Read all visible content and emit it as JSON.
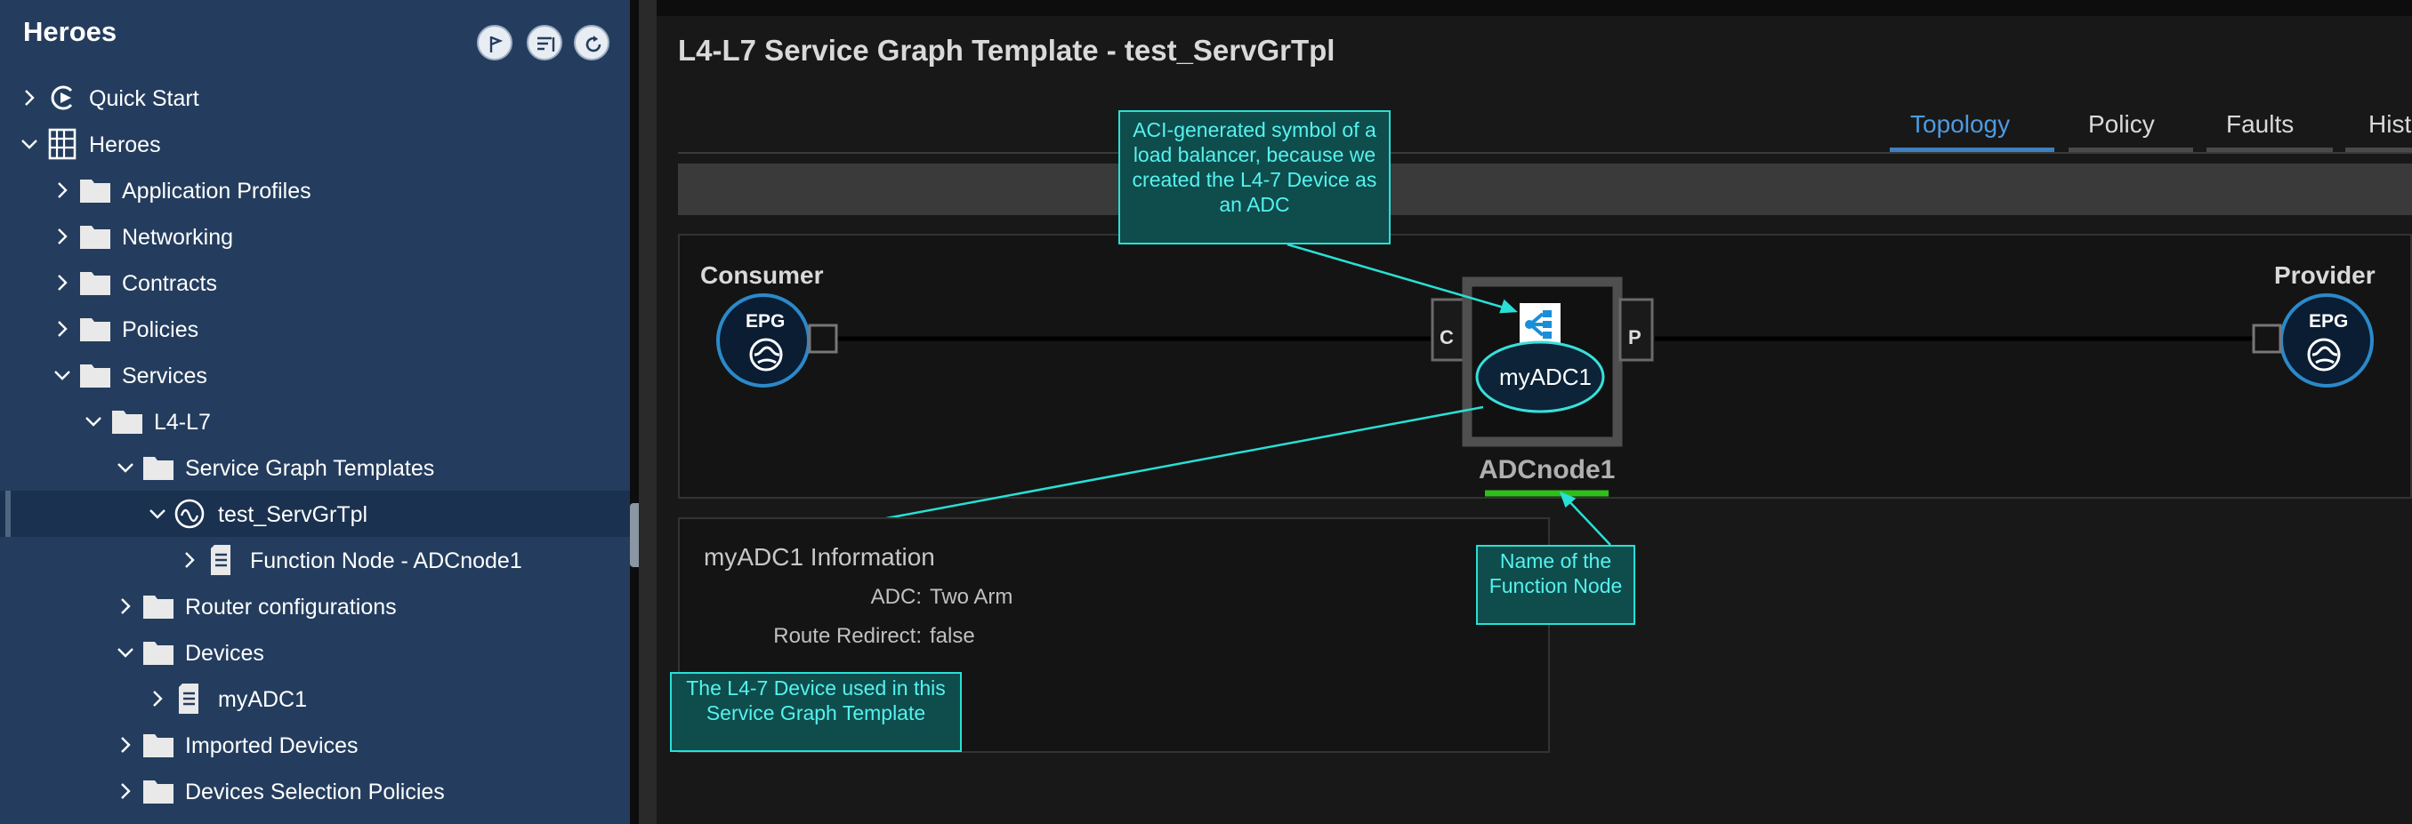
{
  "sidebar": {
    "title": "Heroes",
    "header_buttons": [
      "pin-icon",
      "filter-icon",
      "refresh-icon"
    ],
    "tree": [
      {
        "label": "Quick Start"
      },
      {
        "label": "Heroes"
      },
      {
        "label": "Application Profiles"
      },
      {
        "label": "Networking"
      },
      {
        "label": "Contracts"
      },
      {
        "label": "Policies"
      },
      {
        "label": "Services"
      },
      {
        "label": "L4-L7"
      },
      {
        "label": "Service Graph Templates"
      },
      {
        "label": "test_ServGrTpl"
      },
      {
        "label": "Function Node - ADCnode1"
      },
      {
        "label": "Router configurations"
      },
      {
        "label": "Devices"
      },
      {
        "label": "myADC1"
      },
      {
        "label": "Imported Devices"
      },
      {
        "label": "Devices Selection Policies"
      }
    ]
  },
  "main": {
    "title": "L4-L7 Service Graph Template - test_ServGrTpl",
    "tabs": [
      "Topology",
      "Policy",
      "Faults",
      "Hist"
    ],
    "active_tab": "Topology",
    "graph": {
      "consumer_label": "Consumer",
      "provider_label": "Provider",
      "epg_label": "EPG",
      "connector_c": "C",
      "connector_p": "P",
      "device_name": "myADC1",
      "node_name": "ADCnode1"
    },
    "info": {
      "title": "myADC1 Information",
      "rows": [
        {
          "key": "ADC:",
          "value": "Two Arm"
        },
        {
          "key": "Route Redirect:",
          "value": "false"
        }
      ]
    }
  },
  "annotations": {
    "symbol": "ACI-generated symbol of a load balancer, because we created the L4-7 Device as an ADC",
    "function_node": "Name of the Function Node",
    "device": "The L4-7 Device used in this Service Graph Template"
  },
  "colors": {
    "sidebar_bg": "#243d5e",
    "accent_tab": "#4d9be0",
    "callout_border": "#28e0d6",
    "callout_text": "#55f2ee",
    "node_underline": "#2fbf1a"
  }
}
